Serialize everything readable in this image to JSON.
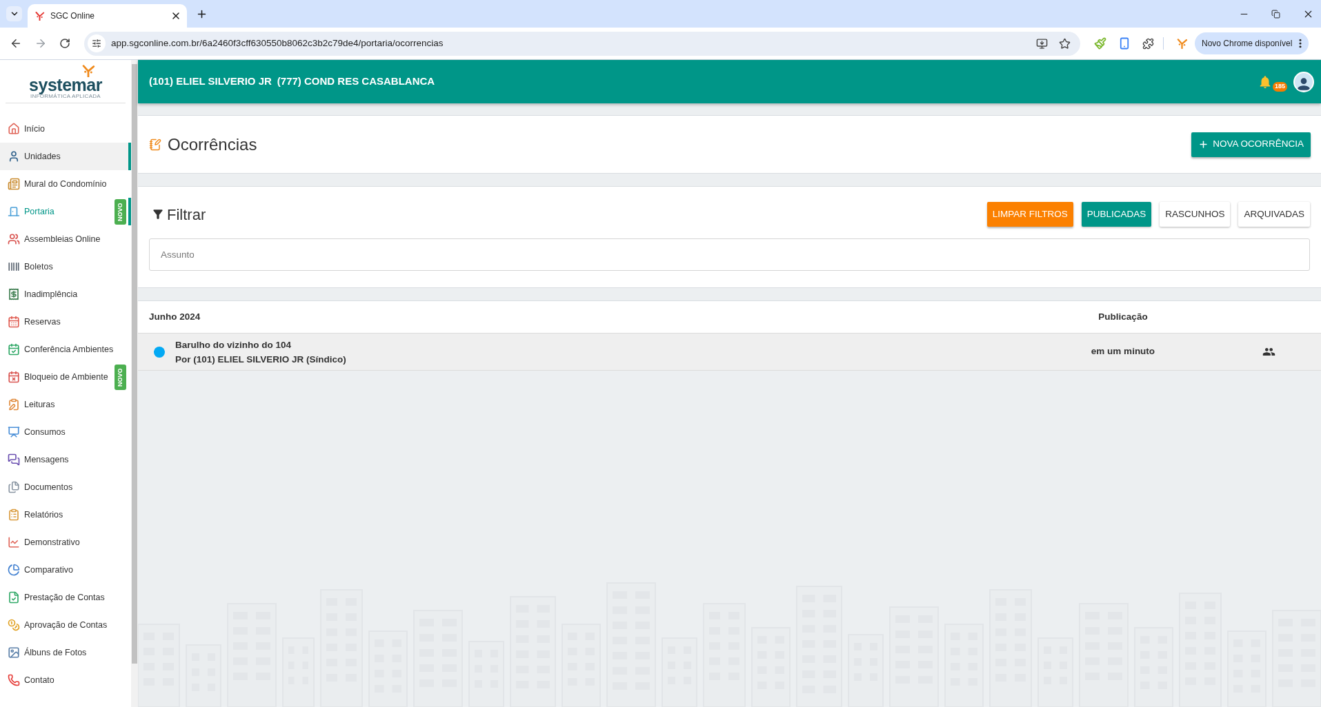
{
  "browser": {
    "tabs": [
      {
        "title": "SGC Online",
        "selected": true
      }
    ],
    "url": "app.sgconline.com.br/6a2460f3cff630550b8062c3b2c79de4/portaria/ocorrencias",
    "update_button": "Novo Chrome disponível"
  },
  "sidebar": {
    "logo": {
      "name": "systemar",
      "tagline": "INFORMÁTICA APLICADA"
    },
    "items": [
      {
        "label": "Início",
        "selected": false,
        "highlighted": false
      },
      {
        "label": "Unidades",
        "selected": false,
        "highlighted": true
      },
      {
        "label": "Mural do Condomínio",
        "selected": false,
        "highlighted": false
      },
      {
        "label": "Portaria",
        "selected": true,
        "highlighted": false,
        "badge": "NOVO"
      },
      {
        "label": "Assembleias Online",
        "selected": false,
        "highlighted": false
      },
      {
        "label": "Boletos",
        "selected": false,
        "highlighted": false
      },
      {
        "label": "Inadimplência",
        "selected": false,
        "highlighted": false
      },
      {
        "label": "Reservas",
        "selected": false,
        "highlighted": false
      },
      {
        "label": "Conferência Ambientes",
        "selected": false,
        "highlighted": false
      },
      {
        "label": "Bloqueio de Ambiente",
        "selected": false,
        "highlighted": false,
        "badge": "NOVO"
      },
      {
        "label": "Leituras",
        "selected": false,
        "highlighted": false
      },
      {
        "label": "Consumos",
        "selected": false,
        "highlighted": false
      },
      {
        "label": "Mensagens",
        "selected": false,
        "highlighted": false
      },
      {
        "label": "Documentos",
        "selected": false,
        "highlighted": false
      },
      {
        "label": "Relatórios",
        "selected": false,
        "highlighted": false
      },
      {
        "label": "Demonstrativo",
        "selected": false,
        "highlighted": false
      },
      {
        "label": "Comparativo",
        "selected": false,
        "highlighted": false
      },
      {
        "label": "Prestação de Contas",
        "selected": false,
        "highlighted": false
      },
      {
        "label": "Aprovação de Contas",
        "selected": false,
        "highlighted": false
      },
      {
        "label": "Álbuns de Fotos",
        "selected": false,
        "highlighted": false
      },
      {
        "label": "Contato",
        "selected": false,
        "highlighted": false
      }
    ]
  },
  "header": {
    "unit": "(101) ELIEL SILVERIO JR",
    "condominium": "(777) COND RES CASABLANCA",
    "notification_count": "185"
  },
  "page": {
    "title": "Ocorrências",
    "new_button": "NOVA OCORRÊNCIA"
  },
  "filter": {
    "title": "Filtrar",
    "clear_button": "LIMPAR FILTROS",
    "status_tabs": [
      {
        "label": "PUBLICADAS",
        "selected": true
      },
      {
        "label": "RASCUNHOS",
        "selected": false
      },
      {
        "label": "ARQUIVADAS",
        "selected": false
      }
    ],
    "search": {
      "placeholder": "Assunto"
    }
  },
  "list": {
    "month": "Junho 2024",
    "column_publication": "Publicação",
    "rows": [
      {
        "title": "Barulho do vizinho do 104",
        "author": "Por (101) ELIEL SILVERIO JR (Síndico)",
        "published": "em um minuto",
        "color": "#03a9f4"
      }
    ]
  }
}
